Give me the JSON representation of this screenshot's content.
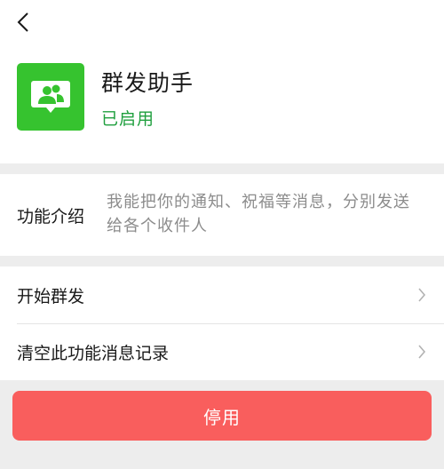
{
  "header": {
    "back_icon": "chevron-left-icon"
  },
  "app": {
    "icon": "group-chat-icon",
    "icon_color": "#36c32f",
    "name": "群发助手",
    "status": "已启用",
    "status_color": "#1f9f3e"
  },
  "intro": {
    "label": "功能介绍",
    "text": "我能把你的通知、祝福等消息，分别发送给各个收件人"
  },
  "menu": {
    "items": [
      {
        "label": "开始群发",
        "icon": "chevron-right-icon"
      },
      {
        "label": "清空此功能消息记录",
        "icon": "chevron-right-icon"
      }
    ]
  },
  "actions": {
    "stop_label": "停用",
    "stop_color": "#f95e5d"
  }
}
